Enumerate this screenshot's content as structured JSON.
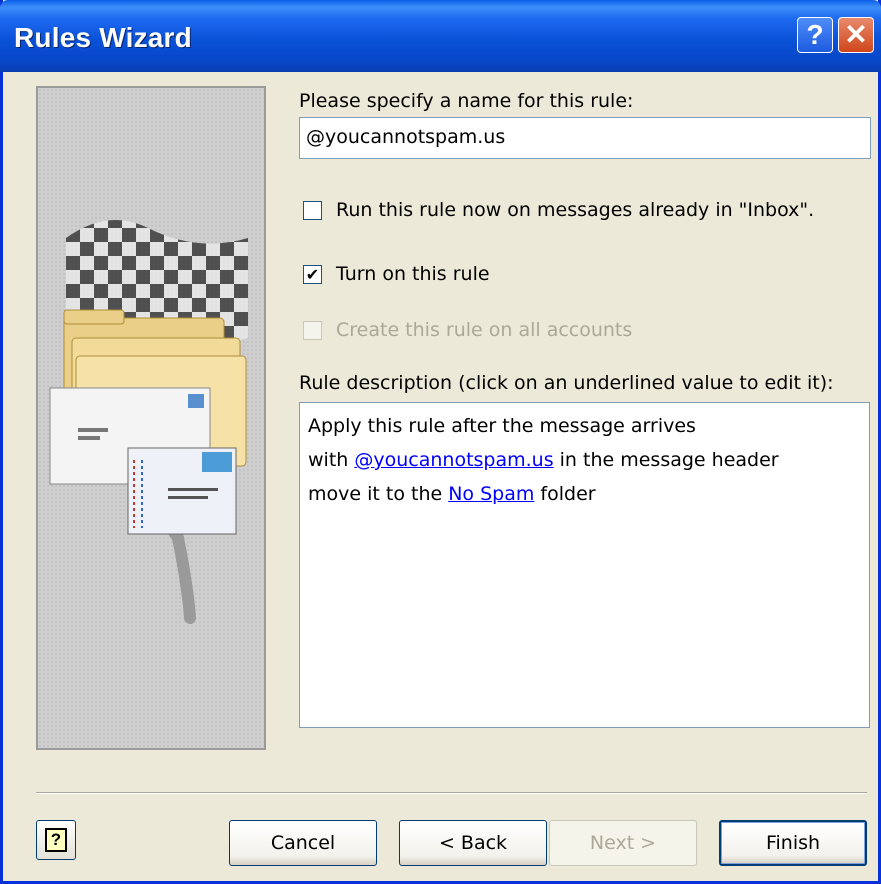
{
  "window": {
    "title": "Rules Wizard",
    "help_glyph": "?",
    "close_glyph": "✕"
  },
  "form": {
    "name_label": "Please specify a name for this rule:",
    "name_value": "@youcannotspam.us",
    "run_now": {
      "label": "Run this rule now on messages already in \"Inbox\".",
      "checked": false,
      "enabled": true
    },
    "turn_on": {
      "label": "Turn on this rule",
      "checked": true,
      "enabled": true
    },
    "all_accounts": {
      "label": "Create this rule on all accounts",
      "checked": false,
      "enabled": false
    },
    "description_label": "Rule description (click on an underlined value to edit it):"
  },
  "description": {
    "line1": "Apply this rule after the message arrives",
    "line2_prefix": "with ",
    "line2_link": "@youcannotspam.us",
    "line2_suffix": " in the message header",
    "line3_prefix": "move it to the ",
    "line3_link": "No Spam",
    "line3_suffix": " folder"
  },
  "buttons": {
    "cancel": "Cancel",
    "back": "< Back",
    "next": "Next >",
    "finish": "Finish",
    "help_glyph": "?"
  },
  "colors": {
    "title_bar": "#0A52D8",
    "dialog_bg": "#ECE9D8",
    "link": "#0000FF",
    "disabled_text": "#ACA899"
  }
}
